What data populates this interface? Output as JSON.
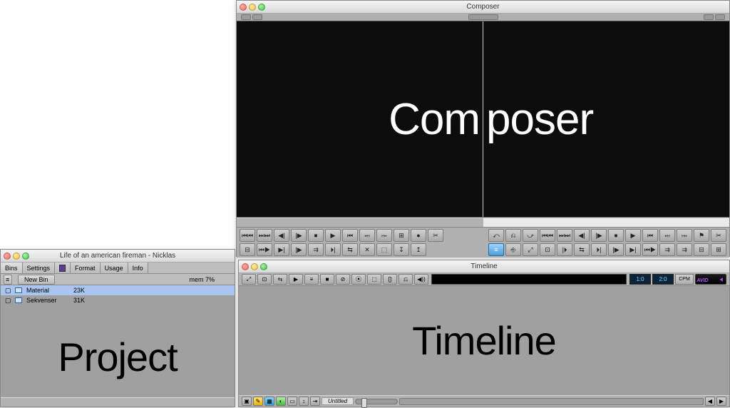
{
  "composer": {
    "title": "Composer",
    "overlay_left": "Com",
    "overlay_right": "poser",
    "transport_row1_left": [
      "⏮⏮",
      "⏭⏭",
      "◀|",
      "|▶",
      "⏹",
      "▶",
      "⏮",
      "⤟",
      "⤠",
      "⊞",
      "●",
      "✂"
    ],
    "transport_row1_right": [
      "⤺",
      "⎌",
      "⤻",
      "⏮⏮",
      "⏭⏭",
      "◀|",
      "|▶",
      "⏹",
      "▶",
      "⏮",
      "⤟",
      "⤠",
      "⚑",
      "✂"
    ],
    "transport_row2_left": [
      "⊟",
      "⏮▶",
      "▶|",
      "|▶",
      "⇉",
      "⏵|",
      "⇆",
      "✕",
      "⬚",
      "↧",
      "↥"
    ],
    "transport_row2_right": [
      "⊞",
      "⊟",
      "⇉",
      "⇉",
      "⏮▶",
      "▶|",
      "|▶",
      "⏵|",
      "⇆",
      "|⏵",
      "⊡",
      "⤢",
      "⎆",
      "≡"
    ]
  },
  "project": {
    "title": "Life of an american fireman - Nicklas",
    "tabs": [
      "Bins",
      "Settings",
      "",
      "Format",
      "Usage",
      "Info"
    ],
    "new_bin_label": "New Bin",
    "mem_label": "mem 7%",
    "bins": [
      {
        "name": "Material",
        "size": "23K",
        "selected": true
      },
      {
        "name": "Sekvenser",
        "size": "31K",
        "selected": false
      }
    ],
    "overlay": "Project"
  },
  "timeline": {
    "title": "Timeline",
    "overlay": "Timeline",
    "tc1": "1:0",
    "tc2": "2:0",
    "cpm": "CPM",
    "brand": "AVID",
    "seq_label": "Untitled",
    "toolbar": [
      "⤢",
      "⊡",
      "⇆",
      "▶",
      "≡",
      "■",
      "⊘",
      "⦿",
      "⬚",
      "[]",
      "⎌",
      "◀))"
    ]
  }
}
